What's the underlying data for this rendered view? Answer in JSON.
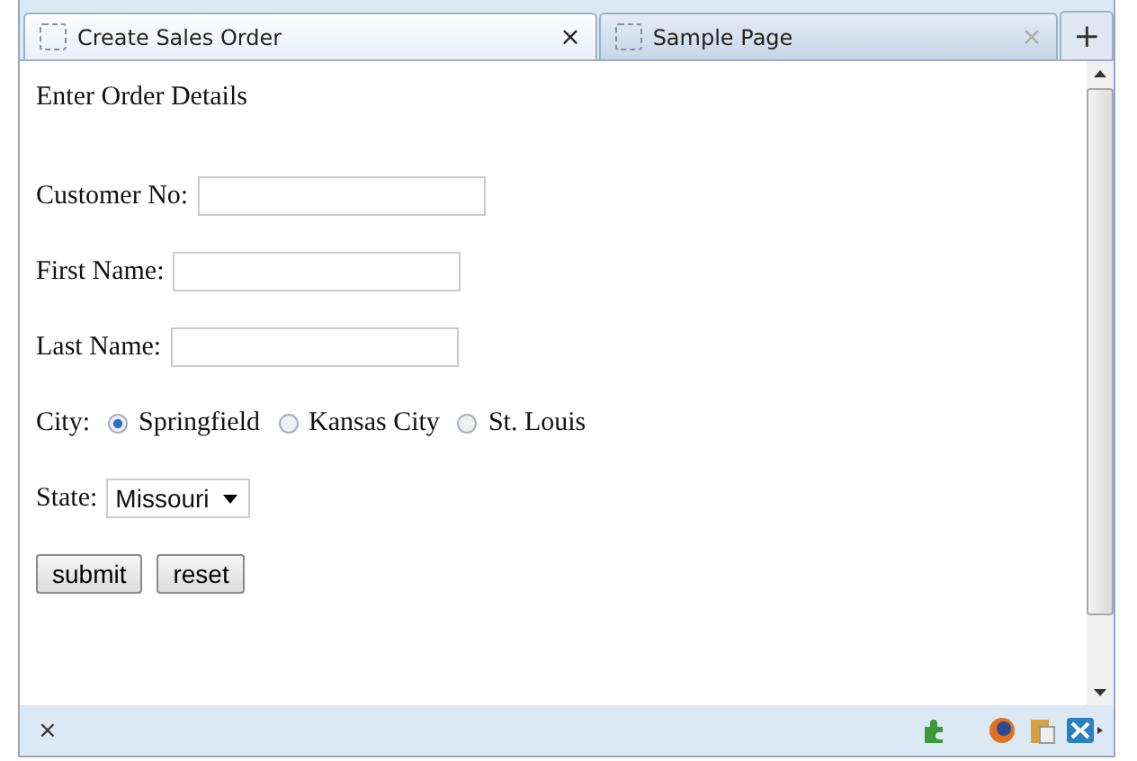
{
  "tabs": [
    {
      "label": "Create Sales Order",
      "close": "×",
      "selected": true
    },
    {
      "label": "Sample Page",
      "close": "×",
      "selected": false
    }
  ],
  "new_tab": "+",
  "heading": "Enter Order Details",
  "fields": [
    {
      "label": "Customer No:"
    },
    {
      "label": "First Name:"
    },
    {
      "label": "Last Name:"
    }
  ],
  "city": {
    "label": "City:",
    "options": [
      {
        "label": "Springfield",
        "selected": true
      },
      {
        "label": "Kansas City",
        "selected": false
      },
      {
        "label": "St. Louis",
        "selected": false
      }
    ]
  },
  "state": {
    "label": "State:",
    "value": "Missouri"
  },
  "buttons": [
    "submit",
    "reset"
  ],
  "status_bar": {
    "close": "×"
  }
}
